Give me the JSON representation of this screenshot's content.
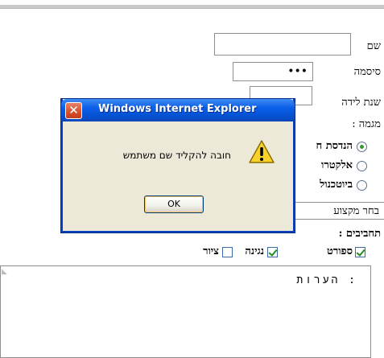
{
  "form": {
    "name_label": "שם",
    "password_label": "סיסמה",
    "password_value": "•••",
    "birth_year_label": "שנת לידה",
    "major_label": "מגמה :",
    "major_options": [
      "הנדסת ח",
      "אלקטרו",
      "ביוטכנול"
    ],
    "major_selected_index": 0,
    "profession_select": "בחר מקצוע",
    "hobbies_label": "תחביבים :",
    "hobbies": [
      {
        "label": "ספורט",
        "checked": true
      },
      {
        "label": "נגינה",
        "checked": true
      },
      {
        "label": "ציור",
        "checked": false
      }
    ],
    "notes_label": ": הערות"
  },
  "dialog": {
    "title": "Windows Internet Explorer",
    "message": "חובה להקליד שם משתמש",
    "ok_label": "OK",
    "icon": "warning-icon",
    "close_icon": "close-icon"
  },
  "colors": {
    "titlebar": "#0a5ee8",
    "dialog_bg": "#ece9d8",
    "check_green": "#1e8f1e",
    "close_red": "#d4502b"
  }
}
